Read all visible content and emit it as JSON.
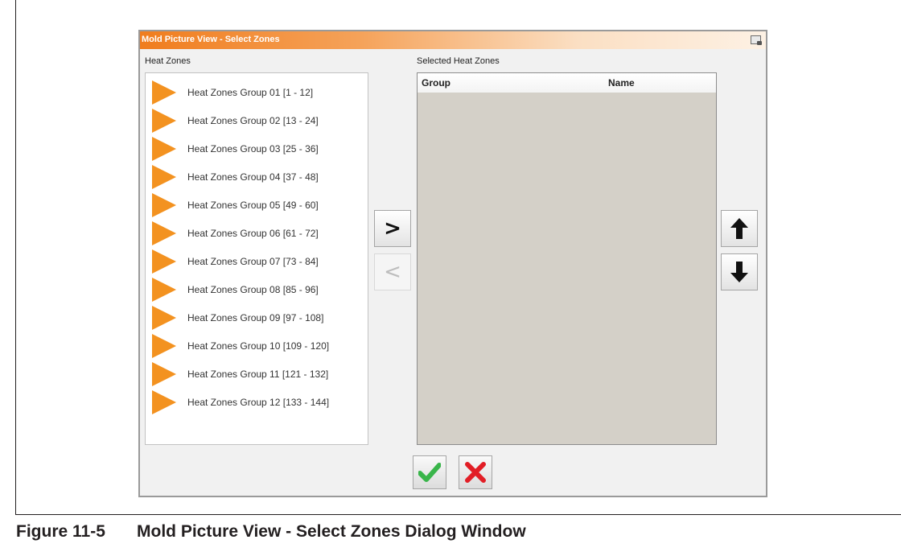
{
  "dialog": {
    "title": "Mold Picture View - Select Zones",
    "heat_zones_label": "Heat Zones",
    "selected_label": "Selected Heat Zones",
    "columns": [
      "Group",
      "Name"
    ],
    "zones": [
      "Heat Zones Group 01 [1 - 12]",
      "Heat Zones Group 02 [13 - 24]",
      "Heat Zones Group 03 [25 - 36]",
      "Heat Zones Group 04 [37 - 48]",
      "Heat Zones Group 05 [49 - 60]",
      "Heat Zones Group 06 [61 - 72]",
      "Heat Zones Group 07 [73 - 84]",
      "Heat Zones Group 08 [85 - 96]",
      "Heat Zones Group 09 [97 - 108]",
      "Heat Zones Group 10 [109 - 120]",
      "Heat Zones Group 11 [121 - 132]",
      "Heat Zones Group 12 [133 - 144]"
    ],
    "add_glyph": ">",
    "remove_glyph": "<",
    "icons": {
      "title": "camera-icon",
      "add": "chevron-right-icon",
      "remove": "chevron-left-icon",
      "up": "arrow-up-icon",
      "down": "arrow-down-icon",
      "ok": "checkmark-icon",
      "cancel": "close-icon"
    },
    "colors": {
      "accent": "#f39220",
      "ok": "#39b54a",
      "cancel": "#e21e26"
    }
  },
  "caption": {
    "number": "Figure 11-5",
    "text": "Mold Picture View - Select Zones Dialog Window"
  }
}
